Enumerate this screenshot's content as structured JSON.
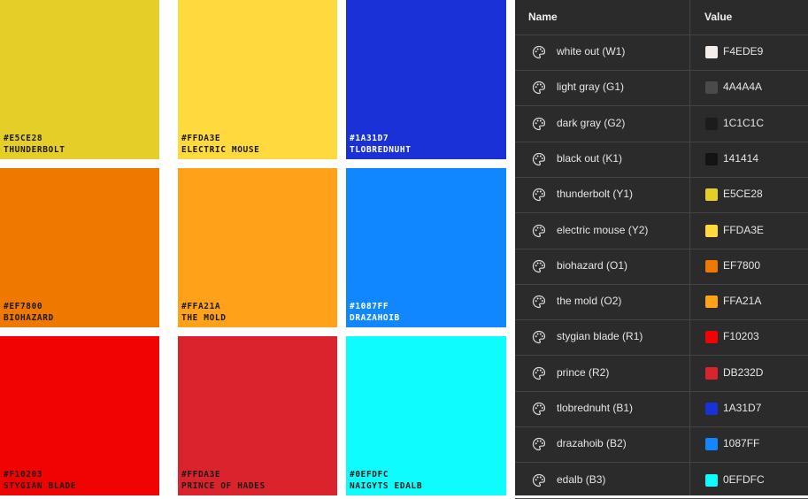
{
  "swatches": [
    {
      "hex": "#E5CE28",
      "name": "THUNDERBOLT",
      "bg": "#E5CE28",
      "fg": "#1a1a1a"
    },
    {
      "hex": "#FFDA3E",
      "name": "ELECTRIC MOUSE",
      "bg": "#FFDA3E",
      "fg": "#1a1a1a"
    },
    {
      "hex": "#1A31D7",
      "name": "TLOBREDNUHT",
      "bg": "#1A31D7",
      "fg": "#ffffff"
    },
    {
      "hex": "#EF7800",
      "name": "BIOHAZARD",
      "bg": "#EF7800",
      "fg": "#1a1a1a"
    },
    {
      "hex": "#FFA21A",
      "name": "THE MOLD",
      "bg": "#FFA21A",
      "fg": "#1a1a1a"
    },
    {
      "hex": "#1087FF",
      "name": "DRAZAHOIB",
      "bg": "#1087FF",
      "fg": "#ffffff"
    },
    {
      "hex": "#F10203",
      "name": "STYGIAN BLADE",
      "bg": "#F10203",
      "fg": "#1a1a1a"
    },
    {
      "hex": "#FFDA3E",
      "name": "PRINCE OF HADES",
      "bg": "#DB232D",
      "fg": "#1a1a1a"
    },
    {
      "hex": "#0EFDFC",
      "name": "NAIGYTS EDALB",
      "bg": "#0EFDFC",
      "fg": "#1a1a1a"
    }
  ],
  "table": {
    "headers": {
      "name": "Name",
      "value": "Value"
    },
    "rows": [
      {
        "name": "white out (W1)",
        "value": "F4EDE9",
        "color": "#F4EDE9"
      },
      {
        "name": "light gray (G1)",
        "value": "4A4A4A",
        "color": "#4A4A4A"
      },
      {
        "name": "dark gray (G2)",
        "value": "1C1C1C",
        "color": "#1C1C1C"
      },
      {
        "name": "black out (K1)",
        "value": "141414",
        "color": "#141414"
      },
      {
        "name": "thunderbolt (Y1)",
        "value": "E5CE28",
        "color": "#E5CE28"
      },
      {
        "name": "electric mouse (Y2)",
        "value": "FFDA3E",
        "color": "#FFDA3E"
      },
      {
        "name": "biohazard (O1)",
        "value": "EF7800",
        "color": "#EF7800"
      },
      {
        "name": "the mold (O2)",
        "value": "FFA21A",
        "color": "#FFA21A"
      },
      {
        "name": "stygian blade (R1)",
        "value": "F10203",
        "color": "#F10203"
      },
      {
        "name": "prince (R2)",
        "value": "DB232D",
        "color": "#DB232D"
      },
      {
        "name": "tlobrednuht (B1)",
        "value": "1A31D7",
        "color": "#1A31D7"
      },
      {
        "name": "drazahoib (B2)",
        "value": "1087FF",
        "color": "#1087FF"
      },
      {
        "name": "edalb (B3)",
        "value": "0EFDFC",
        "color": "#0EFDFC"
      }
    ]
  },
  "icons": {
    "row_icon": "palette-icon"
  }
}
